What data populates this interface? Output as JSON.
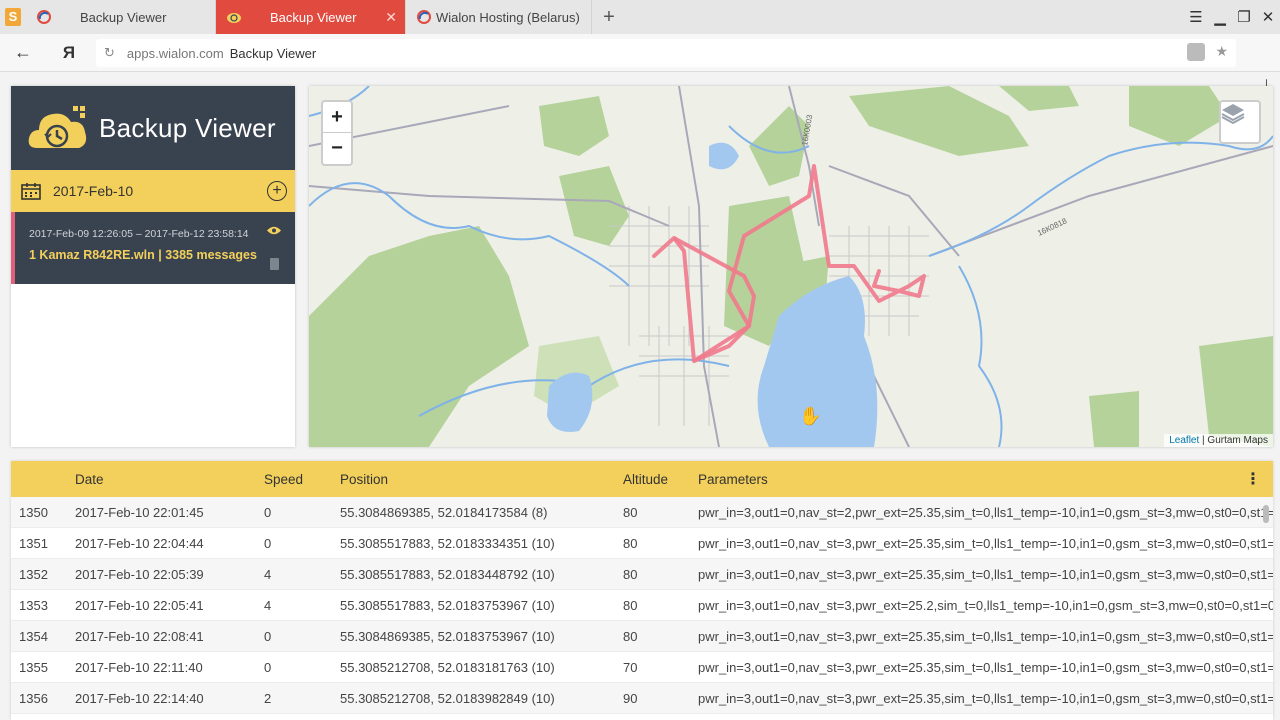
{
  "browser": {
    "tabs": [
      {
        "label": "Backup Viewer",
        "active": false
      },
      {
        "label": "Backup Viewer",
        "active": true
      },
      {
        "label": "Wialon Hosting (Belarus)",
        "active": false
      }
    ],
    "new_tab": "+",
    "yandex_button": "Я",
    "address": {
      "domain": "apps.wialon.com",
      "page_title": "Backup Viewer"
    },
    "colors": {
      "active_tab": "#e04a3f"
    }
  },
  "sidebar": {
    "app_title": "Backup Viewer",
    "date": "2017-Feb-10",
    "backup": {
      "range": "2017-Feb-09 12:26:05 – 2017-Feb-12 23:58:14",
      "file": "1 Kamaz R842RE.wln | 3385 messages"
    },
    "colors": {
      "header": "#39424f",
      "accent": "#f3d05c",
      "marker": "#e0607c"
    }
  },
  "map": {
    "zoom_in": "+",
    "zoom_out": "−",
    "attribution_link": "Leaflet",
    "attribution_text": " | Gurtam Maps",
    "road_labels": [
      "16К0003",
      "16К0818"
    ],
    "track_color": "#f07a8c"
  },
  "table": {
    "headers": [
      "",
      "Date",
      "Speed",
      "Position",
      "Altitude",
      "Parameters"
    ],
    "rows": [
      [
        "1350",
        "2017-Feb-10 22:01:45",
        "0",
        "55.3084869385, 52.0184173584 (8)",
        "80",
        "pwr_in=3,out1=0,nav_st=2,pwr_ext=25.35,sim_t=0,lls1_temp=-10,in1=0,gsm_st=3,mw=0,st0=0,st1="
      ],
      [
        "1351",
        "2017-Feb-10 22:04:44",
        "0",
        "55.3085517883, 52.0183334351 (10)",
        "80",
        "pwr_in=3,out1=0,nav_st=3,pwr_ext=25.35,sim_t=0,lls1_temp=-10,in1=0,gsm_st=3,mw=0,st0=0,st1="
      ],
      [
        "1352",
        "2017-Feb-10 22:05:39",
        "4",
        "55.3085517883, 52.0183448792 (10)",
        "80",
        "pwr_in=3,out1=0,nav_st=3,pwr_ext=25.35,sim_t=0,lls1_temp=-10,in1=0,gsm_st=3,mw=0,st0=0,st1="
      ],
      [
        "1353",
        "2017-Feb-10 22:05:41",
        "4",
        "55.3085517883, 52.0183753967 (10)",
        "80",
        "pwr_in=3,out1=0,nav_st=3,pwr_ext=25.2,sim_t=0,lls1_temp=-10,in1=0,gsm_st=3,mw=0,st0=0,st1=0"
      ],
      [
        "1354",
        "2017-Feb-10 22:08:41",
        "0",
        "55.3084869385, 52.0183753967 (10)",
        "80",
        "pwr_in=3,out1=0,nav_st=3,pwr_ext=25.35,sim_t=0,lls1_temp=-10,in1=0,gsm_st=3,mw=0,st0=0,st1="
      ],
      [
        "1355",
        "2017-Feb-10 22:11:40",
        "0",
        "55.3085212708, 52.0183181763 (10)",
        "70",
        "pwr_in=3,out1=0,nav_st=3,pwr_ext=25.35,sim_t=0,lls1_temp=-10,in1=0,gsm_st=3,mw=0,st0=0,st1="
      ],
      [
        "1356",
        "2017-Feb-10 22:14:40",
        "2",
        "55.3085212708, 52.0183982849 (10)",
        "90",
        "pwr_in=3,out1=0,nav_st=3,pwr_ext=25.35,sim_t=0,lls1_temp=-10,in1=0,gsm_st=3,mw=0,st0=0,st1="
      ]
    ]
  }
}
